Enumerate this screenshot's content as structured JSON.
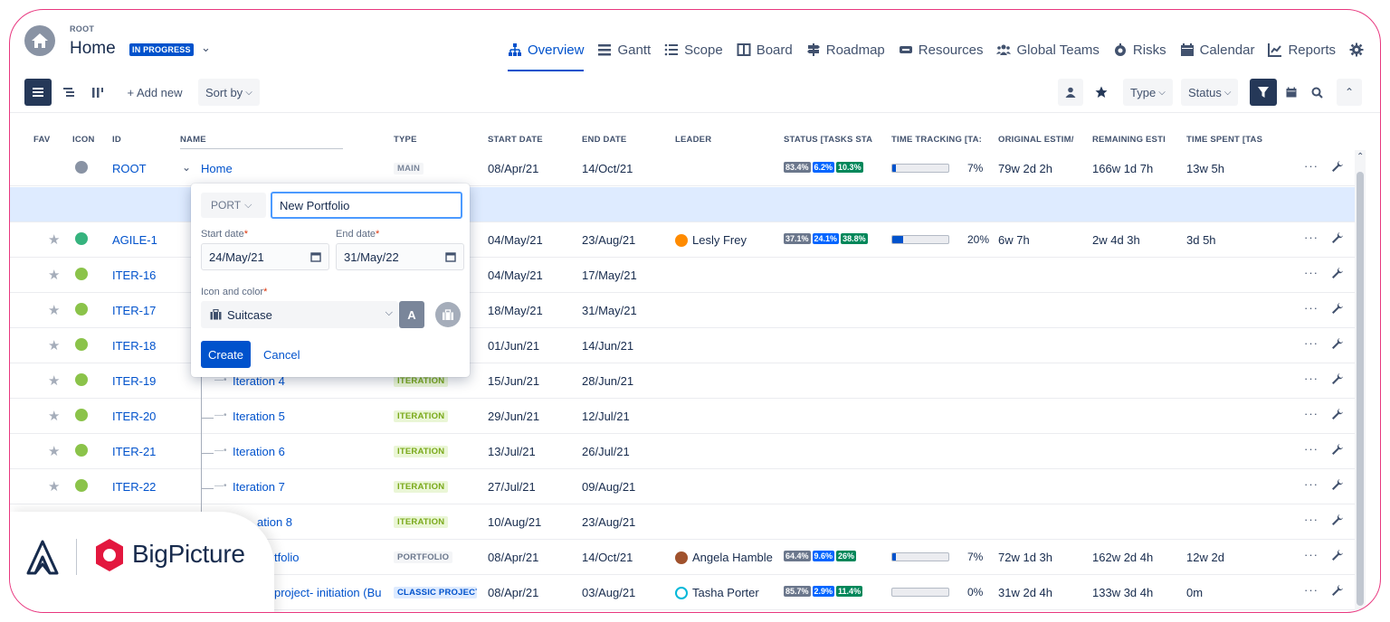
{
  "header": {
    "breadcrumb": "ROOT",
    "title": "Home",
    "status": "IN PROGRESS"
  },
  "nav": [
    {
      "label": "Overview",
      "icon": "hierarchy-icon",
      "active": true
    },
    {
      "label": "Gantt",
      "icon": "gantt-icon"
    },
    {
      "label": "Scope",
      "icon": "list-icon"
    },
    {
      "label": "Board",
      "icon": "board-icon"
    },
    {
      "label": "Roadmap",
      "icon": "signpost-icon"
    },
    {
      "label": "Resources",
      "icon": "resources-icon"
    },
    {
      "label": "Global Teams",
      "icon": "teams-icon"
    },
    {
      "label": "Risks",
      "icon": "risk-icon"
    },
    {
      "label": "Calendar",
      "icon": "calendar-icon"
    },
    {
      "label": "Reports",
      "icon": "chart-icon"
    }
  ],
  "toolbar": {
    "add_new": "+ Add new",
    "sort_by": "Sort by",
    "type_filter": "Type",
    "status_filter": "Status"
  },
  "columns": {
    "fav": "FAV",
    "icon": "ICON",
    "id": "ID",
    "name": "NAME",
    "type": "TYPE",
    "start": "START DATE",
    "end": "END DATE",
    "leader": "LEADER",
    "status": "STATUS [TASKS STA",
    "tracking": "TIME TRACKING [TA:",
    "orig": "ORIGINAL ESTIM/",
    "rem": "REMAINING ESTI",
    "spent": "TIME SPENT [TAS"
  },
  "rows": [
    {
      "id": "ROOT",
      "name": "Home",
      "type": "MAIN",
      "start": "08/Apr/21",
      "end": "14/Oct/21",
      "leader": "",
      "status": [
        "83.4%",
        "6.2%",
        "10.3%"
      ],
      "tt_fill": 0.06,
      "tt_pct": "7%",
      "orig": "79w 2d 2h",
      "rem": "166w 1d 7h",
      "spent": "13w 5h"
    },
    {
      "id": "AGILE-1",
      "name": "",
      "type": "",
      "start": "04/May/21",
      "end": "23/Aug/21",
      "leader": "Lesly Frey",
      "status": [
        "37.1%",
        "24.1%",
        "38.8%"
      ],
      "tt_fill": 0.2,
      "tt_pct": "20%",
      "orig": "6w 7h",
      "rem": "2w 4d 3h",
      "spent": "3d 5h"
    },
    {
      "id": "ITER-16",
      "name": "",
      "type": "",
      "start": "04/May/21",
      "end": "17/May/21"
    },
    {
      "id": "ITER-17",
      "name": "",
      "type": "",
      "start": "18/May/21",
      "end": "31/May/21"
    },
    {
      "id": "ITER-18",
      "name": "",
      "type": "",
      "start": "01/Jun/21",
      "end": "14/Jun/21"
    },
    {
      "id": "ITER-19",
      "name": "Iteration 4",
      "type": "ITERATION",
      "start": "15/Jun/21",
      "end": "28/Jun/21"
    },
    {
      "id": "ITER-20",
      "name": "Iteration 5",
      "type": "ITERATION",
      "start": "29/Jun/21",
      "end": "12/Jul/21"
    },
    {
      "id": "ITER-21",
      "name": "Iteration 6",
      "type": "ITERATION",
      "start": "13/Jul/21",
      "end": "26/Jul/21"
    },
    {
      "id": "ITER-22",
      "name": "Iteration 7",
      "type": "ITERATION",
      "start": "27/Jul/21",
      "end": "09/Aug/21"
    },
    {
      "id": "",
      "name": "ation 8",
      "type": "ITERATION",
      "start": "10/Aug/21",
      "end": "23/Aug/21"
    },
    {
      "id": "",
      "name": "tfolio",
      "type": "PORTFOLIO",
      "start": "08/Apr/21",
      "end": "14/Oct/21",
      "leader": "Angela Hamble",
      "status": [
        "64.4%",
        "9.6%",
        "26%"
      ],
      "tt_fill": 0.06,
      "tt_pct": "7%",
      "orig": "72w 1d 3h",
      "rem": "162w 2d 4h",
      "spent": "12w 2d"
    },
    {
      "id": "",
      "name": "project- initiation (Bu",
      "type": "CLASSIC PROJECT",
      "start": "08/Apr/21",
      "end": "03/Aug/21",
      "leader": "Tasha Porter",
      "status": [
        "85.7%",
        "2.9%",
        "11.4%"
      ],
      "tt_fill": 0.0,
      "tt_pct": "0%",
      "orig": "31w 2d 4h",
      "rem": "133w 3d 4h",
      "spent": "0m"
    }
  ],
  "popup": {
    "type": "PORT",
    "name_value": "New Portfolio",
    "start_label": "Start date",
    "end_label": "End date",
    "required": "*",
    "start_value": "24/May/21",
    "end_value": "31/May/22",
    "icon_label": "Icon and color",
    "icon_value": "Suitcase",
    "letter": "A",
    "create": "Create",
    "cancel": "Cancel"
  },
  "logo": {
    "text": "BigPicture"
  },
  "colors": {
    "accent": "#0052cc",
    "frame": "#e8377f",
    "logo_red": "#e3173e"
  }
}
